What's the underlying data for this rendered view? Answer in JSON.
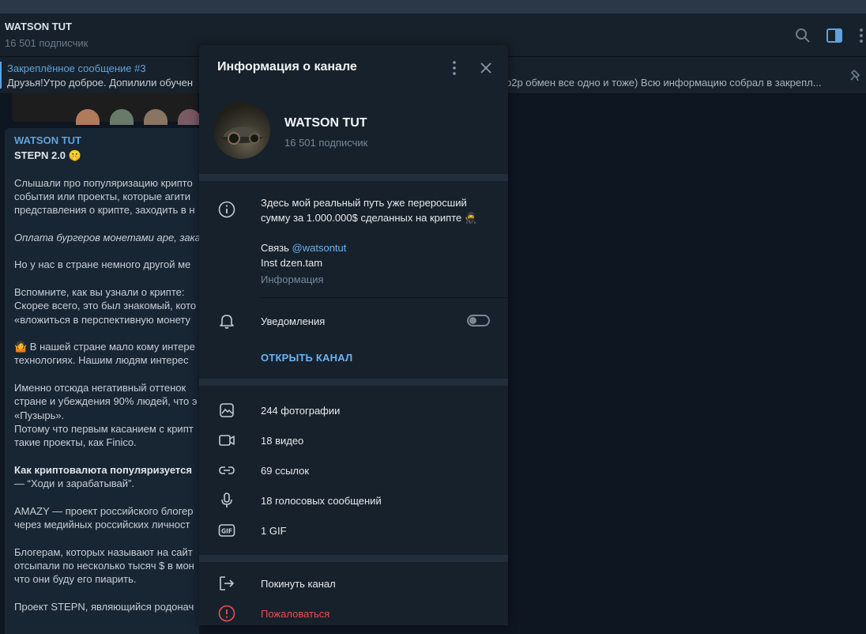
{
  "header": {
    "title": "WATSON TUT",
    "subscribers": "16 501 подписчик"
  },
  "pinned": {
    "title": "Закреплённое сообщение #3",
    "text_left": "Друзья!Утро доброе. Допилили обучен",
    "text_right": "р2р обмен все одно и тоже) Всю информацию собрал в закрепл..."
  },
  "message": {
    "author": "WATSON TUT",
    "title": "STEPN 2.0",
    "lines": [
      "Слышали про популяризацию крипто",
      "события или проекты, которые агити",
      "представления о крипте, заходить в н",
      "",
      "Оплата бургеров монетами аре, заказ",
      "",
      "Но у нас в стране немного другой ме",
      "",
      "Вспомните, как вы узнали о крипте:",
      "Скорее всего, это был знакомый, кото",
      "«вложиться в перспективную монету",
      "",
      "В нашей стране мало кому интере",
      "технологиях. Нашим людям интерес",
      "",
      "Именно отсюда негативный оттенок",
      "стране и убеждения 90% людей, что э",
      "«Пузырь».",
      "Потому что первым касанием с крипт",
      "такие проекты, как Finico.",
      "",
      "Как криптовалюта популяризуется",
      "— “Ходи и зарабатывай”.",
      "",
      "AMAZY — проект российского блогер",
      "через медийных российских личност",
      "",
      "Блогерам, которых называют на сайт",
      "отсыпали по несколько тысяч $ в мон",
      "что они буду его пиарить.",
      "",
      "Проект STEPN, являющийся родонач"
    ]
  },
  "panel": {
    "title": "Информация о канале",
    "channel_name": "WATSON TUT",
    "channel_subscribers": "16 501 подписчик",
    "description_line1": "Здесь мой реальный путь уже переросший",
    "description_line2": "сумму за 1.000.000$ сделанных на крипте",
    "contact_label": "Связь ",
    "contact_handle": "@watsontut",
    "inst": "Inst dzen.tam",
    "info_caption": "Информация",
    "notifications_label": "Уведомления",
    "notifications_on": false,
    "open_channel": "ОТКРЫТЬ КАНАЛ",
    "media": [
      {
        "icon": "photo-icon",
        "label": "244 фотографии"
      },
      {
        "icon": "video-icon",
        "label": "18 видео"
      },
      {
        "icon": "link-icon",
        "label": "69 ссылок"
      },
      {
        "icon": "microphone-icon",
        "label": "18 голосовых сообщений"
      },
      {
        "icon": "gif-icon",
        "label": "1 GIF"
      }
    ],
    "leave": "Покинуть канал",
    "report": "Пожаловаться"
  },
  "colors": {
    "accent": "#6ab3f3",
    "danger": "#ec4f4f",
    "panel_bg": "#17212b",
    "app_bg": "#0e1621"
  }
}
